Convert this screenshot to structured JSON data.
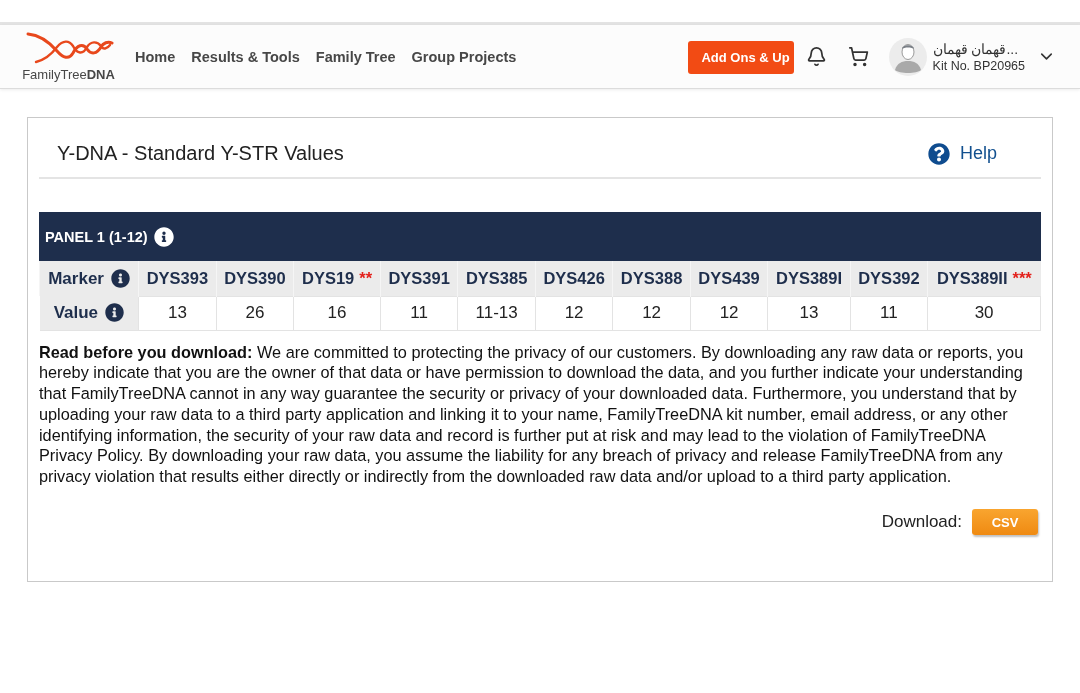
{
  "header": {
    "logo_text": "FamilyTree**DNA**",
    "nav": [
      {
        "label": "Home"
      },
      {
        "label": "Results & Tools"
      },
      {
        "label": "Family Tree"
      },
      {
        "label": "Group Projects"
      }
    ],
    "upgrade_button": "Add Ons & Up",
    "user": {
      "name": "قهمان قهمان...",
      "kit": "Kit No. BP20965"
    }
  },
  "page": {
    "title": "Y-DNA - Standard Y-STR Values",
    "help": "Help"
  },
  "panel": {
    "title": "PANEL 1 (1-12)",
    "marker_label": "Marker",
    "value_label": "Value",
    "markers": [
      {
        "name": "DYS393",
        "value": "13"
      },
      {
        "name": "DYS390",
        "value": "26"
      },
      {
        "name": "DYS19",
        "note": "**",
        "value": "16"
      },
      {
        "name": "DYS391",
        "value": "11"
      },
      {
        "name": "DYS385",
        "value": "11-13"
      },
      {
        "name": "DYS426",
        "value": "12"
      },
      {
        "name": "DYS388",
        "value": "12"
      },
      {
        "name": "DYS439",
        "value": "12"
      },
      {
        "name": "DYS389I",
        "value": "13"
      },
      {
        "name": "DYS392",
        "value": "11"
      },
      {
        "name": "DYS389II",
        "note": "***",
        "value": "30"
      }
    ]
  },
  "notice": "**Read before you download:** We are committed to protecting the privacy of our customers. By downloading any raw data or reports, you hereby indicate that you are the owner of that data or have permission to download the data, and you further indicate your understanding that FamilyTreeDNA cannot in any way guarantee the security or privacy of your downloaded data. Furthermore, you understand that by uploading your raw data to a third party application and linking it to your name, FamilyTreeDNA kit number, email address, or any other identifying information, the security of your raw data and record is further put at risk and may lead to the violation of FamilyTreeDNA Privacy Policy. By downloading your raw data, you assume the liability for any breach of privacy and release FamilyTreeDNA from any privacy violation that results either directly or indirectly from the downloaded raw data and/or upload to a third party application.",
  "download": {
    "label": "Download:",
    "button": "CSV"
  }
}
